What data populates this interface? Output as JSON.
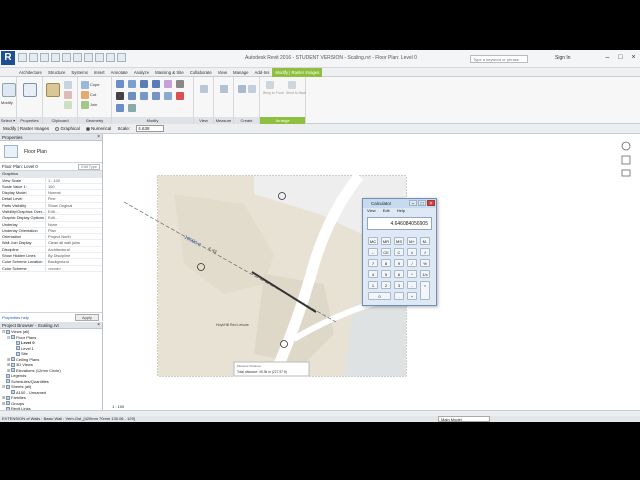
{
  "window": {
    "title": "Autodesk Revit 2016 - STUDENT VERSION -  Scaling.rvt - Floor Plan: Level 0",
    "search_placeholder": "Type a keyword or phrase",
    "sign_in": "Sign In"
  },
  "ribbon_tabs": [
    "Architecture",
    "Structure",
    "Systems",
    "Insert",
    "Annotate",
    "Analyze",
    "Massing & Site",
    "Collaborate",
    "View",
    "Manage",
    "Add-Ins",
    "Modify | Raster Images"
  ],
  "ribbon": {
    "modify_label": "Modify",
    "groups": [
      "Select ▾",
      "Properties",
      "Clipboard",
      "Geometry",
      "Modify",
      "View",
      "Measure",
      "Create",
      "Arrange"
    ],
    "clipboard": {
      "paste": "Paste",
      "cope": "Cope",
      "cut": "Cut",
      "join": "Join"
    },
    "arrange": {
      "bring_front": "Bring to Front",
      "send_back": "Send to Back"
    }
  },
  "options_bar": {
    "context": "Modify | Raster Images",
    "graphical": "Graphical",
    "numerical": "Numerical",
    "scale_label": "Scale:",
    "scale_value": "4.638"
  },
  "properties": {
    "title": "Properties",
    "type_name": "Floor Plan",
    "instance": "Floor Plan: Level 0",
    "edit_type": "Edit Type",
    "group_graphics": "Graphics",
    "rows": [
      [
        "View Scale",
        "1 : 100"
      ],
      [
        "Scale Value    1:",
        "100"
      ],
      [
        "Display Model",
        "Normal"
      ],
      [
        "Detail Level",
        "Fine"
      ],
      [
        "Parts Visibility",
        "Show Original"
      ],
      [
        "Visibility/Graphics Over...",
        "Edit..."
      ],
      [
        "Graphic Display Options",
        "Edit..."
      ],
      [
        "Underlay",
        "None"
      ],
      [
        "Underlay Orientation",
        "Plan"
      ],
      [
        "Orientation",
        "Project North"
      ],
      [
        "Wall Join Display",
        "Clean all wall joins"
      ],
      [
        "Discipline",
        "Architectural"
      ],
      [
        "Show Hidden Lines",
        "By Discipline"
      ],
      [
        "Color Scheme Location",
        "Background"
      ],
      [
        "Color Scheme",
        "<none>"
      ]
    ],
    "help": "Properties help",
    "apply": "Apply"
  },
  "browser": {
    "title": "Project Browser - Scaling.rvt",
    "items": [
      {
        "label": "Views (all)",
        "level": 0,
        "tw": "⊟"
      },
      {
        "label": "Floor Plans",
        "level": 1,
        "tw": "⊟"
      },
      {
        "label": "Level 0",
        "level": 2,
        "tw": ""
      },
      {
        "label": "Level 1",
        "level": 2,
        "tw": ""
      },
      {
        "label": "Site",
        "level": 2,
        "tw": ""
      },
      {
        "label": "Ceiling Plans",
        "level": 1,
        "tw": "⊞"
      },
      {
        "label": "3D Views",
        "level": 1,
        "tw": "⊞"
      },
      {
        "label": "Elevations (12mm Circle)",
        "level": 1,
        "tw": "⊞"
      },
      {
        "label": "Legends",
        "level": 0,
        "tw": ""
      },
      {
        "label": "Schedules/Quantities",
        "level": 0,
        "tw": ""
      },
      {
        "label": "Sheets (all)",
        "level": 0,
        "tw": "⊟"
      },
      {
        "label": "A100 - Unnamed",
        "level": 1,
        "tw": ""
      },
      {
        "label": "Families",
        "level": 0,
        "tw": "⊞"
      },
      {
        "label": "Groups",
        "level": 0,
        "tw": "⊞"
      },
      {
        "label": "Revit Links",
        "level": 0,
        "tw": ""
      }
    ]
  },
  "drawing": {
    "dimension": "10900.0",
    "small_label": "4 :43",
    "building_label": "Hoyt/Hill Red Leisure",
    "measure_title": "Measure Distance",
    "measure_value": "Total distance: 49.36 m (227.97 ft)"
  },
  "calculator": {
    "title": "Calculator",
    "menu": [
      "View",
      "Edit",
      "Help"
    ],
    "display": "4.646084056905",
    "keys": [
      "MC",
      "MR",
      "MS",
      "M+",
      "M-",
      "←",
      "CE",
      "C",
      "±",
      "√",
      "7",
      "8",
      "9",
      "/",
      "%",
      "4",
      "5",
      "6",
      "*",
      "1/x",
      "1",
      "2",
      "3",
      "-",
      "=",
      "0",
      ".",
      "+"
    ]
  },
  "status": {
    "scale": "1 : 100",
    "message": "EXTENSION of Walls : Basic Wall : Verh-Gst_[420mm 70mm 130.06 - 129]",
    "model": "Main Model",
    "coord": ":0"
  }
}
